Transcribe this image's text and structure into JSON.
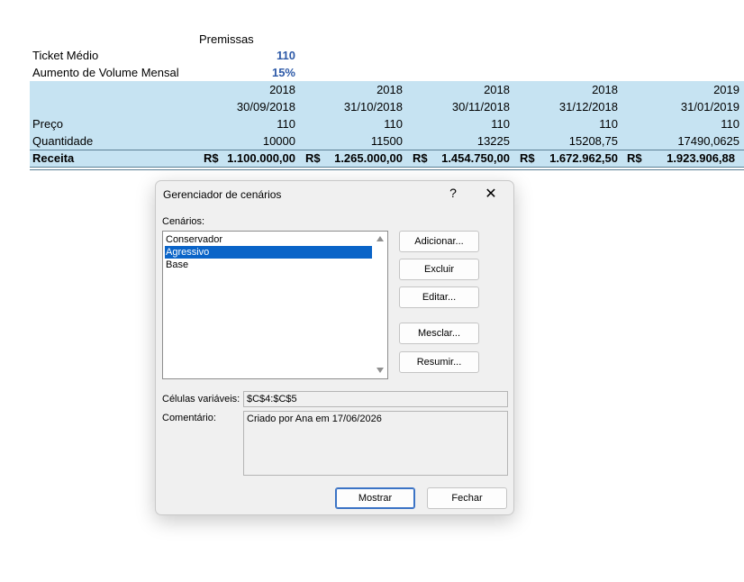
{
  "sheet": {
    "premissas_header": "Premissas",
    "ticket_label": "Ticket Médio",
    "ticket_value": "110",
    "aumento_label": "Aumento de Volume Mensal",
    "aumento_value": "15%",
    "years": [
      "2018",
      "2018",
      "2018",
      "2018",
      "2019"
    ],
    "dates": [
      "30/09/2018",
      "31/10/2018",
      "30/11/2018",
      "31/12/2018",
      "31/01/2019"
    ],
    "preco_label": "Preço",
    "preco_values": [
      "110",
      "110",
      "110",
      "110",
      "110"
    ],
    "quantidade_label": "Quantidade",
    "quantidade_values": [
      "10000",
      "11500",
      "13225",
      "15208,75",
      "17490,0625"
    ],
    "receita_label": "Receita",
    "currency": "R$",
    "receita_values": [
      "1.100.000,00",
      "1.265.000,00",
      "1.454.750,00",
      "1.672.962,50",
      "1.923.906,88"
    ]
  },
  "dialog": {
    "title": "Gerenciador de cenários",
    "help_glyph": "?",
    "close_glyph": "✕",
    "scenarios_label": "Cenários:",
    "scenarios": [
      "Conservador",
      "Agressivo",
      "Base"
    ],
    "selected_index": 1,
    "buttons": {
      "add": "Adicionar...",
      "delete": "Excluir",
      "edit": "Editar...",
      "merge": "Mesclar...",
      "summary": "Resumir...",
      "show": "Mostrar",
      "close": "Fechar"
    },
    "changing_cells_label": "Células variáveis:",
    "changing_cells_value": "$C$4:$C$5",
    "comment_label": "Comentário:",
    "comment_value": "Criado por Ana em 17/06/2026"
  }
}
